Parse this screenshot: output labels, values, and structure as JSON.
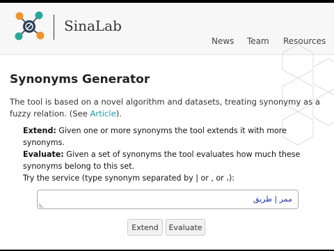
{
  "brand": {
    "name": "SinaLab"
  },
  "nav": {
    "items": [
      "News",
      "Team",
      "Resources"
    ]
  },
  "main": {
    "title": "Synonyms Generator",
    "desc_before": "The tool is based on a novel algorithm and datasets, treating synonymy as a fuzzy relation. (See ",
    "desc_link": "Article",
    "desc_after": ").",
    "extend_term": "Extend:",
    "extend_text": " Given one or more synonyms the tool extends it with more synonyms.",
    "evaluate_term": "Evaluate:",
    "evaluate_text": " Given a set of synonyms the tool evaluates how much these synonyms belong to this set.",
    "try_text": "Try the service (type synonym separated by | or , or ،):"
  },
  "input": {
    "value": "ممر | طريق"
  },
  "buttons": {
    "extend": "Extend",
    "evaluate": "Evaluate"
  },
  "colors": {
    "link": "#1f9aa8",
    "logo_orange": "#f0932b",
    "logo_teal": "#2aa79b"
  }
}
